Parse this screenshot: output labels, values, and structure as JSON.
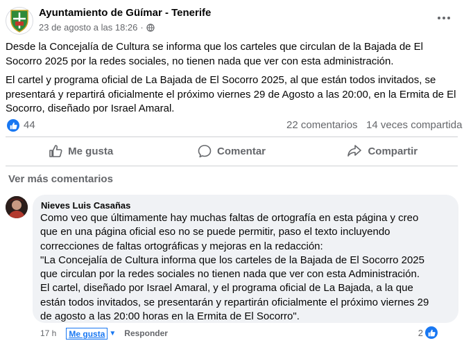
{
  "post": {
    "page_name": "Ayuntamiento de Güímar - Tenerife",
    "date": "23 de agosto a las 18:26",
    "separator": "·",
    "paragraphs": [
      "Desde la Concejalía de Cultura se informa que los carteles que circulan de la Bajada de El Socorro 2025 por la redes sociales, no tienen nada que ver con esta administración.",
      "El cartel y programa oficial de La Bajada de El Socorro 2025, al que están todos invitados, se presentará y repartirá oficialmente el próximo viernes 29 de Agosto a las 20:00, en la Ermita de El Socorro, diseñado por Israel Amaral."
    ]
  },
  "stats": {
    "likes": "44",
    "comments": "22 comentarios",
    "shares": "14 veces compartida"
  },
  "actions": {
    "like": "Me gusta",
    "comment": "Comentar",
    "share": "Compartir"
  },
  "more_comments": "Ver más comentarios",
  "comment": {
    "author": "Nieves Luis Casañas",
    "lines": [
      "Como veo que últimamente hay muchas faltas de ortografía en esta página y creo",
      "que en una página oficial eso no se puede permitir, paso el texto incluyendo",
      "correcciones de faltas ortográficas y mejoras en la redacción:",
      "\"La Concejalía de Cultura informa que los carteles de la Bajada de El Socorro 2025",
      "que circulan por la redes sociales no tienen nada que ver con esta Administración.",
      "El cartel, diseñado por Israel Amaral, y el programa oficial de La Bajada, a la que",
      "están todos invitados, se presentarán y repartirán oficialmente el próximo viernes 29",
      "de agosto a las 20:00 horas en la Ermita de El Socorro\"."
    ],
    "time": "17 h",
    "like_label": "Me gusta",
    "reply_label": "Responder",
    "reaction_count": "2"
  },
  "colors": {
    "accent": "#1877f2",
    "secondary_text": "#65676b",
    "bubble": "#f0f2f5"
  },
  "icons": [
    "crest-logo",
    "globe-icon",
    "more-icon",
    "like-badge-icon",
    "thumbs-up-icon",
    "comment-icon",
    "share-icon",
    "caret-down-icon"
  ]
}
